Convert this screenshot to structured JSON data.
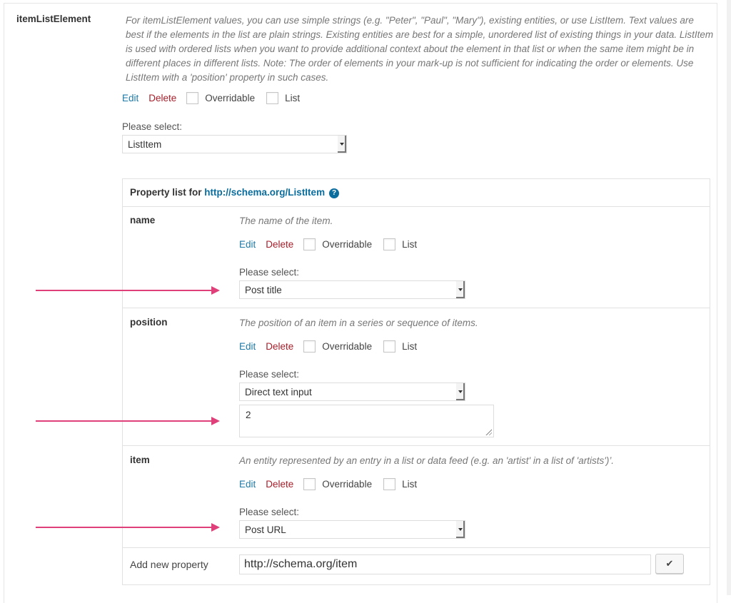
{
  "main_property": {
    "label": "itemListElement",
    "description": "For itemListElement values, you can use simple strings (e.g. \"Peter\", \"Paul\", \"Mary\"), existing entities, or use ListItem. Text values are best if the elements in the list are plain strings. Existing entities are best for a simple, unordered list of existing things in your data. ListItem is used with ordered lists when you want to provide additional context about the element in that list or when the same item might be in different places in different lists. Note: The order of elements in your mark-up is not sufficient for indicating the order or elements. Use ListItem with a 'position' property in such cases.",
    "edit_label": "Edit",
    "delete_label": "Delete",
    "overridable_label": "Overridable",
    "list_label": "List",
    "select_label": "Please select:",
    "select_value": "ListItem"
  },
  "property_list": {
    "title_prefix": "Property list for",
    "title_link": "http://schema.org/ListItem",
    "help_icon": "?",
    "rows": [
      {
        "label": "name",
        "description": "The name of the item.",
        "edit_label": "Edit",
        "delete_label": "Delete",
        "overridable_label": "Overridable",
        "list_label": "List",
        "select_label": "Please select:",
        "select_value": "Post title"
      },
      {
        "label": "position",
        "description": "The position of an item in a series or sequence of items.",
        "edit_label": "Edit",
        "delete_label": "Delete",
        "overridable_label": "Overridable",
        "list_label": "List",
        "select_label": "Please select:",
        "select_value": "Direct text input",
        "text_value": "2"
      },
      {
        "label": "item",
        "description": "An entity represented by an entry in a list or data feed (e.g. an 'artist' in a list of 'artists')’.",
        "edit_label": "Edit",
        "delete_label": "Delete",
        "overridable_label": "Overridable",
        "list_label": "List",
        "select_label": "Please select:",
        "select_value": "Post URL"
      }
    ],
    "add_new": {
      "label": "Add new property",
      "input_value": "http://schema.org/item",
      "confirm_icon": "✔"
    }
  },
  "colors": {
    "link": "#1f7aa8",
    "delete": "#a71e2a",
    "annotation_arrow": "#e0407a"
  }
}
